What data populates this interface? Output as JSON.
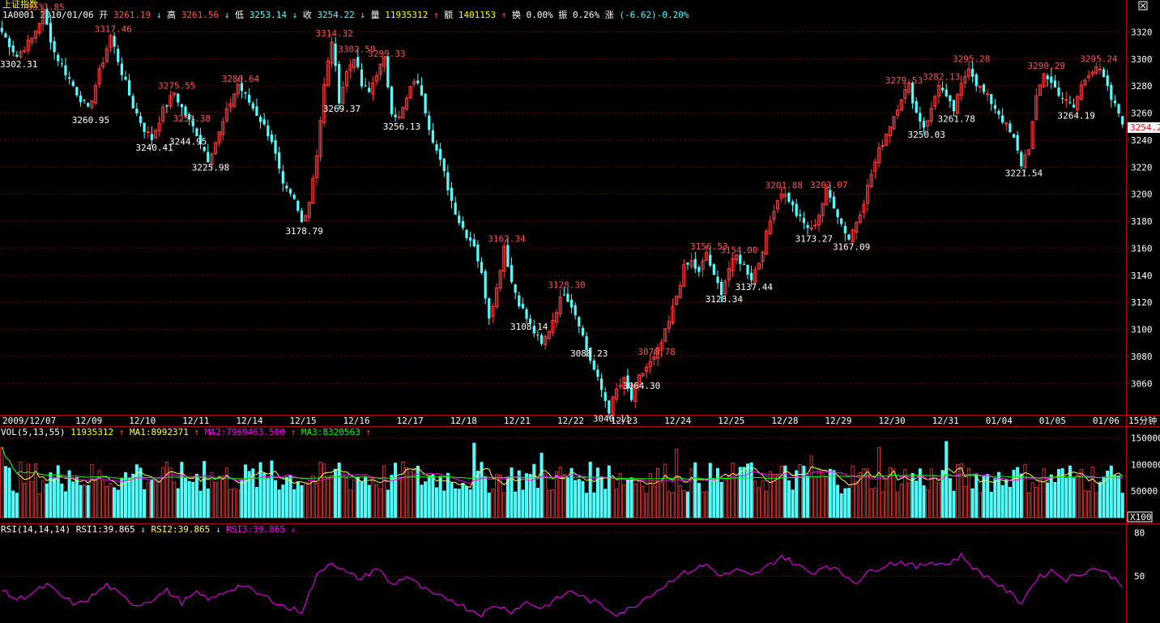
{
  "header": {
    "title": "上证指数",
    "code": "1A0001",
    "date": "2010/01/06",
    "open_label": "开",
    "open": "3261.19",
    "high_label": "高",
    "high": "3261.56",
    "low_label": "低",
    "low": "3253.14",
    "close_label": "收",
    "close": "3254.22",
    "vol_label": "量",
    "vol": "11935312",
    "amount_label": "额",
    "amount": "1401153",
    "turnover_label": "换",
    "turnover": "0.00%",
    "amplitude_label": "振",
    "amplitude": "0.26%",
    "change_label": "涨",
    "change": "(-6.62)-0.20%",
    "up_arrow": "↑",
    "down_arrow": "↓",
    "period": "15分钟"
  },
  "colors": {
    "background": "#000000",
    "up": "#FF3C3C",
    "down": "#54FCFC",
    "grid": "#7A0000",
    "axis": "#B00000",
    "text_white": "#FFFFFF",
    "text_yellow": "#FFFF00",
    "ma1": "#FFFF54",
    "ma2": "#FF00FF",
    "ma3": "#00FF00",
    "rsi": "#FF00FF",
    "label_high": "#FF5454",
    "label_low": "#FFFFFF",
    "price_marker": "#FFFFFF"
  },
  "volume_header": {
    "name": "VOL(5,13,55)",
    "value": "11935312",
    "ma1_label": "MA1:8992371",
    "ma2_label": "MA2:7969463.500",
    "ma3_label": "MA3:8320563",
    "multiplier": "X100"
  },
  "rsi_header": {
    "name": "RSI(14,14,14)",
    "rsi1_label": "RSI1:39.865",
    "rsi2_label": "RSI2:39.865",
    "rsi3_label": "RSI3:39.865"
  },
  "chart_data": {
    "type": "candlestick",
    "price_axis": {
      "ticks": [
        "3320",
        "3300",
        "3280",
        "3260",
        "3240",
        "3220",
        "3200",
        "3180",
        "3160",
        "3140",
        "3120",
        "3100",
        "3080",
        "3060"
      ],
      "ylim": [
        3038,
        3340
      ],
      "current_price_label": "3254.2"
    },
    "volume_axis": {
      "ticks": [
        "150000",
        "100000",
        "50000"
      ],
      "ylim": [
        0,
        160000
      ]
    },
    "rsi_axis": {
      "ticks": [
        "80",
        "50"
      ],
      "ylim": [
        20,
        83
      ]
    },
    "dates": [
      "2009/12/07",
      "12/09",
      "12/10",
      "12/11",
      "12/14",
      "12/15",
      "12/16",
      "12/17",
      "12/18",
      "12/21",
      "12/22",
      "12/23",
      "12/24",
      "12/25",
      "12/28",
      "12/29",
      "12/30",
      "12/31",
      "01/04",
      "01/05",
      "01/06"
    ],
    "price_path": [
      [
        0,
        3320
      ],
      [
        4,
        3302
      ],
      [
        8,
        3315
      ],
      [
        11,
        3334
      ],
      [
        14,
        3305
      ],
      [
        17,
        3290
      ],
      [
        20,
        3275
      ],
      [
        23,
        3262
      ],
      [
        26,
        3290
      ],
      [
        29,
        3317
      ],
      [
        32,
        3290
      ],
      [
        35,
        3265
      ],
      [
        38,
        3248
      ],
      [
        40,
        3241
      ],
      [
        43,
        3262
      ],
      [
        46,
        3275
      ],
      [
        49,
        3258
      ],
      [
        52,
        3245
      ],
      [
        55,
        3226
      ],
      [
        58,
        3245
      ],
      [
        61,
        3268
      ],
      [
        63,
        3281
      ],
      [
        66,
        3268
      ],
      [
        69,
        3255
      ],
      [
        72,
        3240
      ],
      [
        75,
        3205
      ],
      [
        78,
        3195
      ],
      [
        80,
        3179
      ],
      [
        82,
        3195
      ],
      [
        84,
        3230
      ],
      [
        86,
        3280
      ],
      [
        88,
        3314
      ],
      [
        90,
        3270
      ],
      [
        92,
        3290
      ],
      [
        94,
        3302
      ],
      [
        96,
        3280
      ],
      [
        98,
        3275
      ],
      [
        100,
        3290
      ],
      [
        102,
        3299
      ],
      [
        104,
        3262
      ],
      [
        106,
        3256
      ],
      [
        108,
        3270
      ],
      [
        110,
        3285
      ],
      [
        112,
        3275
      ],
      [
        114,
        3250
      ],
      [
        116,
        3232
      ],
      [
        118,
        3215
      ],
      [
        120,
        3195
      ],
      [
        122,
        3180
      ],
      [
        124,
        3170
      ],
      [
        126,
        3163
      ],
      [
        128,
        3140
      ],
      [
        130,
        3110
      ],
      [
        132,
        3130
      ],
      [
        134,
        3162
      ],
      [
        136,
        3135
      ],
      [
        138,
        3120
      ],
      [
        140,
        3108
      ],
      [
        142,
        3098
      ],
      [
        144,
        3088
      ],
      [
        146,
        3100
      ],
      [
        148,
        3115
      ],
      [
        150,
        3128
      ],
      [
        152,
        3118
      ],
      [
        154,
        3105
      ],
      [
        156,
        3085
      ],
      [
        158,
        3070
      ],
      [
        160,
        3055
      ],
      [
        162,
        3040
      ],
      [
        164,
        3055
      ],
      [
        166,
        3062
      ],
      [
        168,
        3048
      ],
      [
        170,
        3064
      ],
      [
        172,
        3072
      ],
      [
        174,
        3078
      ],
      [
        176,
        3090
      ],
      [
        178,
        3105
      ],
      [
        180,
        3125
      ],
      [
        182,
        3145
      ],
      [
        184,
        3150
      ],
      [
        186,
        3141
      ],
      [
        188,
        3157
      ],
      [
        190,
        3138
      ],
      [
        192,
        3128
      ],
      [
        194,
        3145
      ],
      [
        196,
        3154
      ],
      [
        198,
        3147
      ],
      [
        200,
        3138
      ],
      [
        202,
        3150
      ],
      [
        204,
        3170
      ],
      [
        206,
        3190
      ],
      [
        208,
        3202
      ],
      [
        210,
        3196
      ],
      [
        212,
        3185
      ],
      [
        214,
        3178
      ],
      [
        216,
        3173
      ],
      [
        218,
        3185
      ],
      [
        220,
        3202
      ],
      [
        222,
        3192
      ],
      [
        224,
        3178
      ],
      [
        226,
        3167
      ],
      [
        228,
        3180
      ],
      [
        230,
        3195
      ],
      [
        232,
        3215
      ],
      [
        234,
        3232
      ],
      [
        236,
        3245
      ],
      [
        238,
        3258
      ],
      [
        240,
        3272
      ],
      [
        242,
        3280
      ],
      [
        244,
        3260
      ],
      [
        246,
        3250
      ],
      [
        248,
        3262
      ],
      [
        250,
        3282
      ],
      [
        252,
        3270
      ],
      [
        254,
        3262
      ],
      [
        256,
        3280
      ],
      [
        258,
        3295
      ],
      [
        260,
        3282
      ],
      [
        262,
        3275
      ],
      [
        264,
        3268
      ],
      [
        266,
        3260
      ],
      [
        268,
        3250
      ],
      [
        270,
        3240
      ],
      [
        272,
        3222
      ],
      [
        274,
        3235
      ],
      [
        276,
        3270
      ],
      [
        278,
        3290
      ],
      [
        280,
        3282
      ],
      [
        282,
        3275
      ],
      [
        284,
        3268
      ],
      [
        286,
        3264
      ],
      [
        288,
        3280
      ],
      [
        290,
        3290
      ],
      [
        292,
        3295
      ],
      [
        294,
        3285
      ],
      [
        296,
        3270
      ],
      [
        298,
        3260
      ],
      [
        299,
        3254
      ]
    ],
    "high_annotations": [
      {
        "bar": 11,
        "value": "3333.85"
      },
      {
        "bar": 29,
        "value": "3317.46"
      },
      {
        "bar": 46,
        "value": "3275.55"
      },
      {
        "bar": 63,
        "value": "3280.64"
      },
      {
        "bar": 88,
        "value": "3314.32"
      },
      {
        "bar": 94,
        "value": "3302.59"
      },
      {
        "bar": 102,
        "value": "3299.33"
      },
      {
        "bar": 50,
        "value": "3251.38"
      },
      {
        "bar": 134,
        "value": "3162.34"
      },
      {
        "bar": 150,
        "value": "3128.30"
      },
      {
        "bar": 174,
        "value": "3078.78"
      },
      {
        "bar": 188,
        "value": "3156.53"
      },
      {
        "bar": 196,
        "value": "3154.00"
      },
      {
        "bar": 208,
        "value": "3201.88"
      },
      {
        "bar": 220,
        "value": "3202.07"
      },
      {
        "bar": 240,
        "value": "3279.53"
      },
      {
        "bar": 250,
        "value": "3282.13"
      },
      {
        "bar": 258,
        "value": "3295.28"
      },
      {
        "bar": 278,
        "value": "3290.29"
      },
      {
        "bar": 292,
        "value": "3295.24"
      }
    ],
    "low_annotations": [
      {
        "bar": 1,
        "value": "3302.31"
      },
      {
        "bar": 23,
        "value": "3260.95"
      },
      {
        "bar": 40,
        "value": "3240.41"
      },
      {
        "bar": 49,
        "value": "3244.95"
      },
      {
        "bar": 55,
        "value": "3225.98"
      },
      {
        "bar": 80,
        "value": "3178.79"
      },
      {
        "bar": 90,
        "value": "3269.37"
      },
      {
        "bar": 106,
        "value": "3256.13"
      },
      {
        "bar": 140,
        "value": "3108.14"
      },
      {
        "bar": 156,
        "value": "3088.23"
      },
      {
        "bar": 162,
        "value": "3040.11"
      },
      {
        "bar": 170,
        "value": "3064.30"
      },
      {
        "bar": 192,
        "value": "3128.34"
      },
      {
        "bar": 200,
        "value": "3137.44"
      },
      {
        "bar": 216,
        "value": "3173.27"
      },
      {
        "bar": 226,
        "value": "3167.09"
      },
      {
        "bar": 246,
        "value": "3250.03"
      },
      {
        "bar": 254,
        "value": "3261.78"
      },
      {
        "bar": 272,
        "value": "3221.54"
      },
      {
        "bar": 286,
        "value": "3264.19"
      }
    ],
    "rsi_path": [
      [
        0,
        40
      ],
      [
        4,
        34
      ],
      [
        8,
        38
      ],
      [
        12,
        44
      ],
      [
        16,
        36
      ],
      [
        20,
        30
      ],
      [
        24,
        36
      ],
      [
        28,
        44
      ],
      [
        32,
        36
      ],
      [
        36,
        30
      ],
      [
        40,
        34
      ],
      [
        44,
        40
      ],
      [
        48,
        32
      ],
      [
        52,
        38
      ],
      [
        56,
        34
      ],
      [
        60,
        40
      ],
      [
        64,
        44
      ],
      [
        68,
        38
      ],
      [
        72,
        34
      ],
      [
        76,
        28
      ],
      [
        80,
        26
      ],
      [
        84,
        50
      ],
      [
        86,
        56
      ],
      [
        88,
        60
      ],
      [
        92,
        52
      ],
      [
        96,
        48
      ],
      [
        100,
        56
      ],
      [
        104,
        44
      ],
      [
        108,
        50
      ],
      [
        112,
        42
      ],
      [
        116,
        36
      ],
      [
        120,
        34
      ],
      [
        124,
        28
      ],
      [
        128,
        24
      ],
      [
        132,
        30
      ],
      [
        136,
        26
      ],
      [
        140,
        32
      ],
      [
        144,
        28
      ],
      [
        148,
        34
      ],
      [
        152,
        40
      ],
      [
        156,
        34
      ],
      [
        160,
        30
      ],
      [
        164,
        24
      ],
      [
        168,
        28
      ],
      [
        172,
        36
      ],
      [
        176,
        42
      ],
      [
        180,
        50
      ],
      [
        184,
        54
      ],
      [
        188,
        58
      ],
      [
        192,
        50
      ],
      [
        196,
        54
      ],
      [
        200,
        50
      ],
      [
        204,
        56
      ],
      [
        208,
        64
      ],
      [
        212,
        58
      ],
      [
        216,
        52
      ],
      [
        220,
        58
      ],
      [
        224,
        52
      ],
      [
        228,
        46
      ],
      [
        232,
        54
      ],
      [
        236,
        58
      ],
      [
        240,
        60
      ],
      [
        244,
        56
      ],
      [
        248,
        60
      ],
      [
        252,
        58
      ],
      [
        256,
        64
      ],
      [
        260,
        54
      ],
      [
        264,
        48
      ],
      [
        268,
        40
      ],
      [
        272,
        32
      ],
      [
        276,
        48
      ],
      [
        280,
        54
      ],
      [
        284,
        48
      ],
      [
        288,
        52
      ],
      [
        292,
        56
      ],
      [
        296,
        50
      ],
      [
        299,
        44
      ]
    ]
  }
}
